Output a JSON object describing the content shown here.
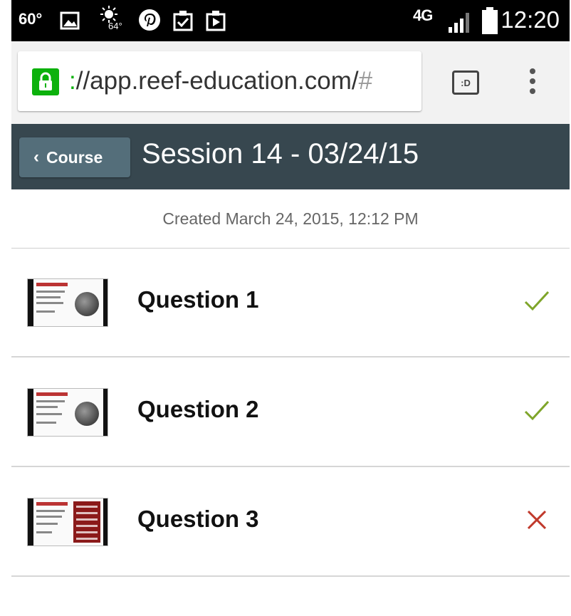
{
  "status_bar": {
    "temperature": "60°",
    "weather_temp": "64°",
    "network": "4G",
    "time": "12:20"
  },
  "browser": {
    "url_prefix": ":",
    "url": "//app.reef-education.com/",
    "url_tail": "#",
    "tabs_label": ":D"
  },
  "header": {
    "back_label": "Course",
    "title": "Session 14 - 03/24/15"
  },
  "created_text": "Created March 24, 2015, 12:12 PM",
  "questions": [
    {
      "label": "Question 1",
      "result": "correct"
    },
    {
      "label": "Question 2",
      "result": "correct"
    },
    {
      "label": "Question 3",
      "result": "incorrect"
    }
  ],
  "colors": {
    "correct": "#7fa52a",
    "incorrect": "#c0392b",
    "header_bg": "#37474f",
    "secure_green": "#0cb10c"
  }
}
